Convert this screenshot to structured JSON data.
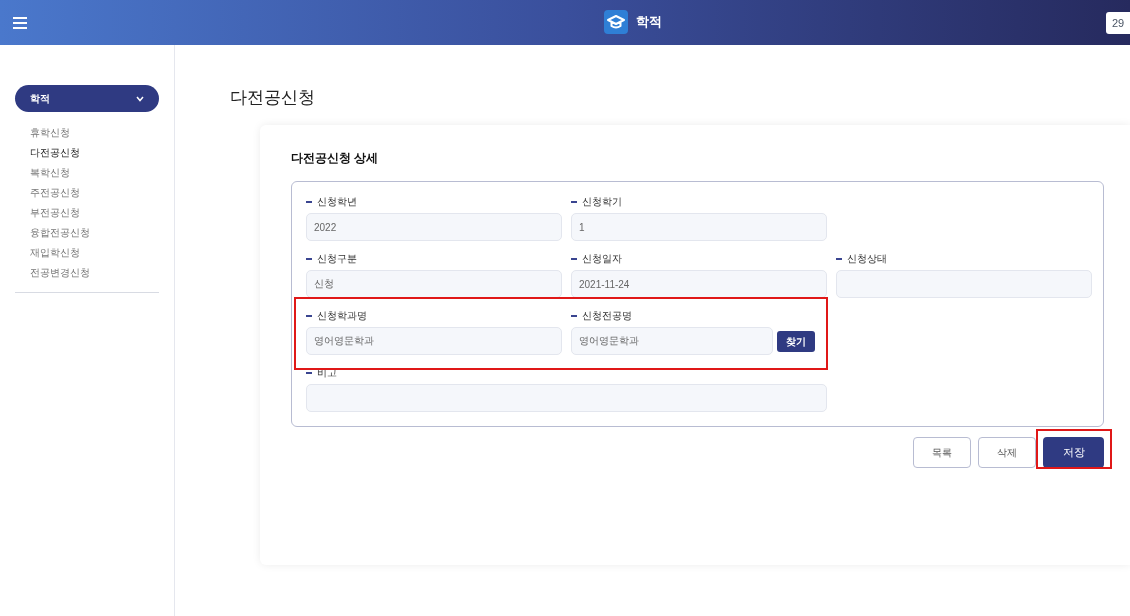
{
  "header": {
    "title": "학적",
    "right_box": "29"
  },
  "sidebar": {
    "menu": {
      "label": "학적",
      "expanded": true
    },
    "items": [
      {
        "label": "휴학신청",
        "selected": false
      },
      {
        "label": "다전공신청",
        "selected": true
      },
      {
        "label": "복학신청",
        "selected": false
      },
      {
        "label": "주전공신청",
        "selected": false
      },
      {
        "label": "부전공신청",
        "selected": false
      },
      {
        "label": "융합전공신청",
        "selected": false
      },
      {
        "label": "재입학신청",
        "selected": false
      },
      {
        "label": "전공변경신청",
        "selected": false
      }
    ]
  },
  "page_title": "다전공신청",
  "section_title": "다전공신청 상세",
  "fields": [
    {
      "kind": "text",
      "label": "신청학년",
      "value": "2022"
    },
    {
      "kind": "text",
      "label": "신청학기",
      "value": "1"
    },
    {
      "kind": "break"
    },
    {
      "kind": "text",
      "label": "신청구분",
      "value": "신청"
    },
    {
      "kind": "text",
      "label": "신청일자",
      "value": "2021-11-24"
    },
    {
      "kind": "text",
      "label": "신청상태"
    },
    {
      "kind": "text",
      "label": "신청학과명",
      "value": "영어영문학과"
    },
    {
      "kind": "search",
      "label": "신청전공명",
      "value": "영어영문학과",
      "button": "찾기"
    },
    {
      "kind": "break"
    },
    {
      "kind": "wide",
      "label": "비고"
    }
  ],
  "buttons": [
    {
      "label": "목록",
      "primary": false
    },
    {
      "label": "삭제",
      "primary": false
    },
    {
      "label": "저장",
      "primary": true
    }
  ]
}
